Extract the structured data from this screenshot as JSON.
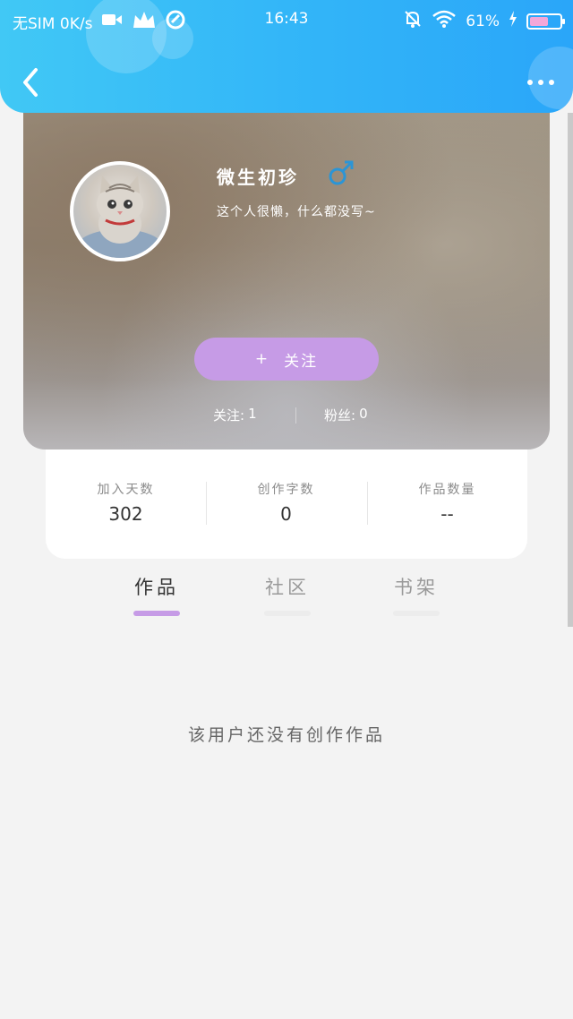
{
  "status_bar": {
    "carrier": "无SIM 0K/s",
    "time": "16:43",
    "battery": "61%",
    "battery_level": 0.61
  },
  "header": {
    "back_icon": "chevron-left-icon",
    "more_icon": "more-dots-icon"
  },
  "profile": {
    "name": "微生初珍",
    "gender_icon": "male-symbol-icon",
    "bio": "这个人很懒，什么都没写~",
    "follow_button": "关注",
    "follow_plus": "+",
    "following": {
      "label": "关注:",
      "value": "1"
    },
    "fans": {
      "label": "粉丝:",
      "value": "0"
    }
  },
  "stats": [
    {
      "label": "加入天数",
      "value": "302"
    },
    {
      "label": "创作字数",
      "value": "0"
    },
    {
      "label": "作品数量",
      "value": "--"
    }
  ],
  "tabs": [
    {
      "label": "作品",
      "active": true
    },
    {
      "label": "社区",
      "active": false
    },
    {
      "label": "书架",
      "active": false
    }
  ],
  "empty_message": "该用户还没有创作作品",
  "colors": {
    "header_gradient": [
      "#41c8f5",
      "#2aa6f9"
    ],
    "accent_purple": "#c69be6",
    "background": "#f3f3f3",
    "gender_blue": "#2b95d6"
  }
}
